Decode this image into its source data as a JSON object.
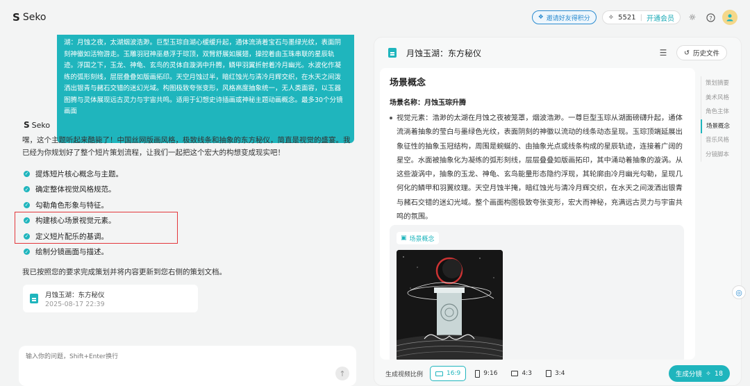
{
  "app": {
    "name": "Seko"
  },
  "header": {
    "invite_label": "邀请好友得积分",
    "credits": "5521",
    "vip_label": "开通会员"
  },
  "chat": {
    "user_message": "湖：月蚀之夜，太湖烟波浩渺。巨型玉琮自湖心缓缓升起，通体流淌着宝石与墨绿光纹，表面阴刻神徽如活物游走。玉雕羽冠神巫悬浮于琮顶，双臂舒展如展翅，操控着由玉珠串联的星辰轨迹。浮国之下，玉龙、神龟、玄鸟的灵体自漩涡中升腾，鳞甲羽翼折射着冷月幽光。水波化作凝练的弧形刻线，层层叠叠如版画拓印。天空月蚀过半，暗红蚀光与清冷月辉交织，在水天之间泼洒出银青与赭石交错的迷幻光域。构图极致夸张变形，风格高度抽象统一，无人类面容，以玉器图腾与灵体展现远古灵力与宇宙共鸣。适用于幻想史诗插画或神秘主题动画概念。最多30个分镜画面",
    "assistant_name": "Seko",
    "assistant_intro": "嘿，这个主题听起来酷毙了！中国丝网版画风格，极致线条和抽象的东方秘仪，简直是视觉的盛宴。我已经为你规划好了整个短片策划流程，让我们一起把这个宏大的构想变成现实吧！",
    "steps": [
      {
        "label": "提炼短片核心概念与主题。"
      },
      {
        "label": "确定整体视觉风格规范。"
      },
      {
        "label": "勾勒角色形象与特征。"
      },
      {
        "label": "构建核心场景视觉元素。"
      },
      {
        "label": "定义短片配乐的基调。"
      },
      {
        "label": "绘制分镜画面与描述。"
      }
    ],
    "done_text": "我已按照您的要求完成策划并将内容更新到您右侧的策划文档。",
    "doc_card": {
      "title": "月蚀玉湖：东方秘仪",
      "date": "2025-08-17 22:39"
    },
    "input_placeholder": "输入你的问题，Shift+Enter换行"
  },
  "panel": {
    "title": "月蚀玉湖：东方秘仪",
    "history_label": "历史文件",
    "section_title": "场景概念",
    "scene_name": "场景名称：月蚀玉琮升腾",
    "description": "视觉元素：浩渺的太湖在月蚀之夜被笼罩，烟波浩渺。一尊巨型玉琮从湖面磅礴升起，通体流淌着抽象的莹白与墨绿色光纹，表面阴刻的神徽以流动的线条动态呈现。玉琮顶端延展出象征性的抽象玉冠结构，周围是蜿蜒的、由抽象光点或线条构成的星辰轨迹，连接着广阔的星空。水面被抽象化为凝练的弧形刻线，层层叠叠如版画拓印，其中涌动着抽象的漩涡。从这些漩涡中，抽象的玉龙、神龟、玄鸟能量形态隐约浮现，其轮廓由冷月幽光勾勒，呈现几何化的鳞甲和羽翼纹理。天空月蚀半掩，暗红蚀光与清冷月辉交织，在水天之间泼洒出银青与赭石交错的迷幻光域。整个画面构图极致夸张变形，宏大而神秘，充满远古灵力与宇宙共鸣的氛围。",
    "image_tag": "场景概念",
    "toc": [
      {
        "label": "策划摘要",
        "active": false
      },
      {
        "label": "美术风格",
        "active": false
      },
      {
        "label": "角色主体",
        "active": false
      },
      {
        "label": "场景概念",
        "active": true
      },
      {
        "label": "音乐风格",
        "active": false
      },
      {
        "label": "分镜脚本",
        "active": false
      }
    ],
    "footer": {
      "ratio_label": "生成视频比例",
      "ratios": [
        {
          "label": "16:9",
          "active": true
        },
        {
          "label": "9:16",
          "active": false
        },
        {
          "label": "4:3",
          "active": false
        },
        {
          "label": "3:4",
          "active": false
        }
      ],
      "generate_label": "生成分镜",
      "generate_cost": "18"
    }
  },
  "colors": {
    "accent": "#1fb5bd",
    "highlight": "#e3363a",
    "link": "#2a8bd0"
  }
}
